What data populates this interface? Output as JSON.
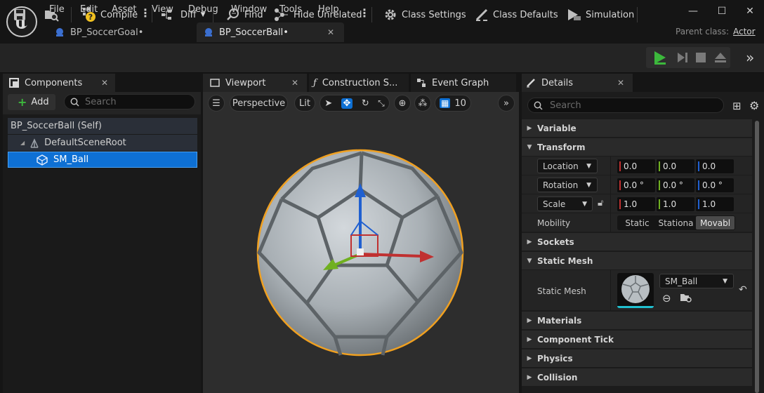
{
  "menu": [
    "File",
    "Edit",
    "Asset",
    "View",
    "Debug",
    "Window",
    "Tools",
    "Help"
  ],
  "tabs": [
    {
      "label": "BP_SoccerGoal•"
    },
    {
      "label": "BP_SoccerBall•"
    }
  ],
  "parent_class": {
    "label": "Parent class:",
    "value": "Actor"
  },
  "toolbar": {
    "compile": "Compile",
    "diff": "Diff",
    "find": "Find",
    "hide_unrelated": "Hide Unrelated",
    "class_settings": "Class Settings",
    "class_defaults": "Class Defaults",
    "simulation": "Simulation"
  },
  "components": {
    "title": "Components",
    "add_label": "Add",
    "search_placeholder": "Search",
    "tree": [
      "BP_SoccerBall (Self)",
      "DefaultSceneRoot",
      "SM_Ball"
    ]
  },
  "viewport": {
    "tabs": [
      "Viewport",
      "Construction S...",
      "Event Graph"
    ],
    "perspective": "Perspective",
    "lit": "Lit",
    "grid_value": "10"
  },
  "details": {
    "title": "Details",
    "search_placeholder": "Search",
    "categories": {
      "variable": "Variable",
      "transform": "Transform",
      "sockets": "Sockets",
      "static_mesh": "Static Mesh",
      "materials": "Materials",
      "component_tick": "Component Tick",
      "physics": "Physics",
      "collision": "Collision"
    },
    "location": {
      "label": "Location",
      "x": "0.0",
      "y": "0.0",
      "z": "0.0"
    },
    "rotation": {
      "label": "Rotation",
      "x": "0.0 °",
      "y": "0.0 °",
      "z": "0.0 °"
    },
    "scale": {
      "label": "Scale",
      "x": "1.0",
      "y": "1.0",
      "z": "1.0"
    },
    "mobility": {
      "label": "Mobility",
      "options": [
        "Static",
        "Stationa",
        "Movabl"
      ],
      "selected": "Movabl"
    },
    "static_mesh_prop": {
      "label": "Static Mesh",
      "value": "SM_Ball"
    }
  },
  "colors": {
    "accent": "#0e70d4",
    "x_axis": "#c03030",
    "y_axis": "#70b020",
    "z_axis": "#2060d0",
    "selection": "#f0a020"
  }
}
